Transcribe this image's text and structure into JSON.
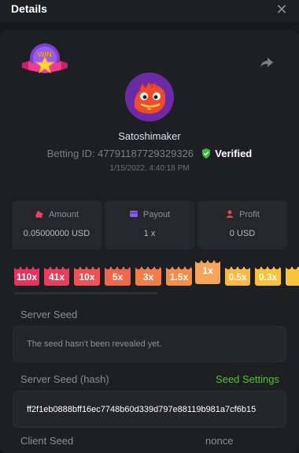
{
  "header": {
    "title": "Details",
    "close_icon": "close-icon"
  },
  "player": {
    "username": "Satoshimaker",
    "betting_label": "Betting ID:",
    "betting_id": "47791187729329326",
    "verified_label": "Verified",
    "date": "1/15/2022, 4:40:18 PM"
  },
  "stats": [
    {
      "title": "Amount",
      "value": "0.05000000 USD",
      "icon": "amount-icon",
      "color": "#ef3f68"
    },
    {
      "title": "Payout",
      "value": "1 x",
      "icon": "payout-icon",
      "color": "#8b5cf6"
    },
    {
      "title": "Profit",
      "value": "0 USD",
      "icon": "profit-icon",
      "color": "#e54848"
    }
  ],
  "multipliers": [
    {
      "label": "110x",
      "color": "#e8315e"
    },
    {
      "label": "41x",
      "color": "#ea3d5c"
    },
    {
      "label": "10x",
      "color": "#ef5155"
    },
    {
      "label": "5x",
      "color": "#f1674e"
    },
    {
      "label": "3x",
      "color": "#f37c4b"
    },
    {
      "label": "1.5x",
      "color": "#f58d48"
    },
    {
      "label": "1x",
      "color": "#f7a55b",
      "active": true
    },
    {
      "label": "0.5x",
      "color": "#f9b943"
    },
    {
      "label": "0.3x",
      "color": "#fbc33a"
    }
  ],
  "server_seed": {
    "label": "Server Seed",
    "value": "The seed hasn't been revealed yet."
  },
  "server_seed_hash": {
    "label": "Server Seed (hash)",
    "seed_settings_label": "Seed Settings",
    "value": "ff2f1eb0888bff16ec7748b60d339d797e88119b981a7cf6b15"
  },
  "client_seed": {
    "label": "Client Seed"
  },
  "nonce": {
    "label": "nonce"
  },
  "colors": {
    "background": "#17181b",
    "panel": "#1e1f23",
    "card": "#26272b",
    "accent_green": "#55c23a"
  }
}
